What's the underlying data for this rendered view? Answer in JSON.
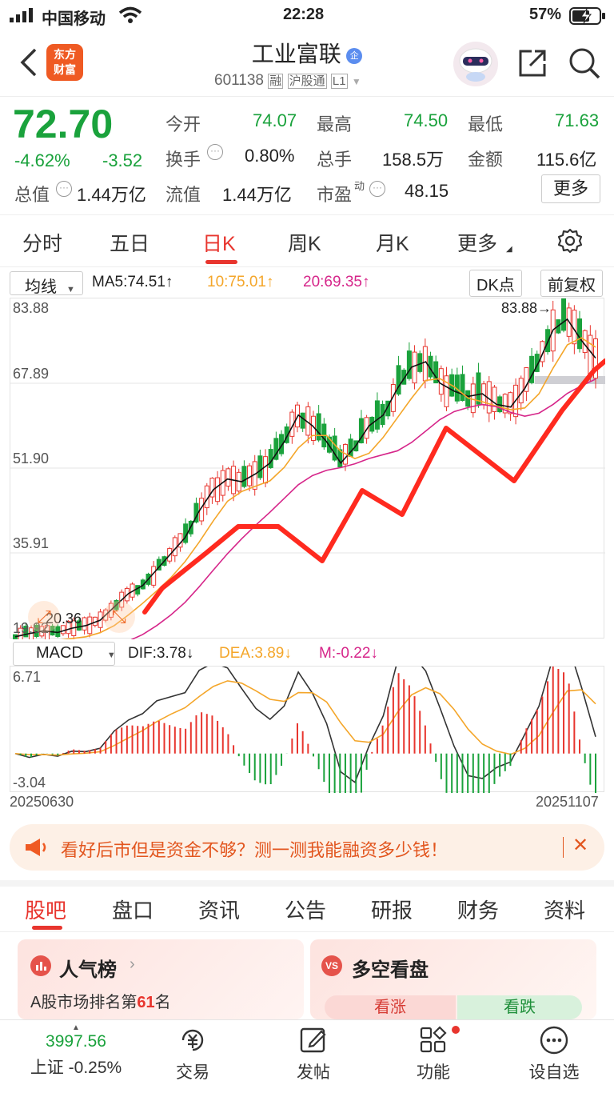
{
  "status": {
    "carrier": "中国移动",
    "time": "22:28",
    "battery": "57%"
  },
  "header": {
    "title": "工业富联",
    "title_badge": "企",
    "code": "601138",
    "tags": [
      "融",
      "沪股通",
      "L1"
    ],
    "logo_line1": "东方",
    "logo_line2": "财富"
  },
  "quote": {
    "price": "72.70",
    "change_pct": "-4.62%",
    "change": "-3.52",
    "fields": [
      {
        "label": "今开",
        "value": "74.07",
        "color": "#1aa23c"
      },
      {
        "label": "最高",
        "value": "74.50",
        "color": "#1aa23c"
      },
      {
        "label": "最低",
        "value": "71.63",
        "color": "#1aa23c"
      },
      {
        "label": "换手",
        "value": "0.80%",
        "color": "#222"
      },
      {
        "label": "总手",
        "value": "158.5万",
        "color": "#222"
      },
      {
        "label": "金额",
        "value": "115.6亿",
        "color": "#222"
      },
      {
        "label": "总值",
        "value": "1.44万亿",
        "color": "#222"
      },
      {
        "label": "流值",
        "value": "1.44万亿",
        "color": "#222"
      },
      {
        "label": "市盈",
        "value": "48.15",
        "color": "#222"
      }
    ],
    "pe_sup": "动",
    "more_label": "更多"
  },
  "tabs": [
    "分时",
    "五日",
    "日K",
    "周K",
    "月K",
    "更多"
  ],
  "active_tab": "日K",
  "ma_bar": {
    "selector": "均线",
    "ma5": "MA5:74.51↑",
    "ma10": "10:75.01↑",
    "ma20": "20:69.35↑",
    "dk": "DK点",
    "adjust": "前复权"
  },
  "kchart": {
    "y_labels": [
      "83.88",
      "67.89",
      "51.90",
      "35.91",
      "19.92"
    ],
    "high_label": "83.88→",
    "low_label": "20.36"
  },
  "macd_bar": {
    "selector": "MACD",
    "dif": "DIF:3.78↓",
    "dea": "DEA:3.89↓",
    "m": "M:-0.22↓"
  },
  "macd": {
    "top": "6.71",
    "bottom": "-3.04",
    "date_start": "20250630",
    "date_end": "20251107"
  },
  "chart_data": {
    "type": "line",
    "title": "",
    "x_range": [
      "20250630",
      "20251107"
    ],
    "ylim": [
      19.92,
      83.88
    ],
    "labeled_levels": [
      83.88,
      67.89,
      51.9,
      35.91,
      19.92
    ],
    "high": 83.88,
    "low": 20.36,
    "series": [
      {
        "name": "MA5",
        "last": 74.51
      },
      {
        "name": "MA10",
        "last": 75.01
      },
      {
        "name": "MA20",
        "last": 69.35
      }
    ],
    "close_path": [
      20.4,
      21,
      21.5,
      21.2,
      22,
      22.5,
      23.5,
      26,
      28.5,
      30,
      33,
      36,
      39,
      44,
      48,
      50,
      49.5,
      51,
      53,
      57,
      62,
      60,
      57,
      53,
      56,
      60,
      62,
      67,
      71,
      72,
      68,
      66.5,
      65.5,
      66,
      64,
      63.5,
      67,
      72,
      78,
      80,
      76,
      72.7
    ],
    "macd": {
      "ylim": [
        -3.04,
        6.71
      ],
      "dif": 3.78,
      "dea": 3.89,
      "m": -0.22
    }
  },
  "banner": {
    "text": "看好后市但是资金不够？测一测我能融资多少钱！"
  },
  "bottom_tabs": [
    "股吧",
    "盘口",
    "资讯",
    "公告",
    "研报",
    "财务",
    "资料"
  ],
  "cards": {
    "popularity_title": "人气榜",
    "popularity_sub_prefix": "A股市场排名第",
    "popularity_rank": "61",
    "popularity_sub_suffix": "名",
    "vs_title": "多空看盘",
    "bull": "看涨",
    "bear": "看跌"
  },
  "nav": {
    "index_value": "3997.56",
    "index_name": "上证 -0.25%",
    "items": [
      "交易",
      "发帖",
      "功能",
      "设自选"
    ]
  }
}
